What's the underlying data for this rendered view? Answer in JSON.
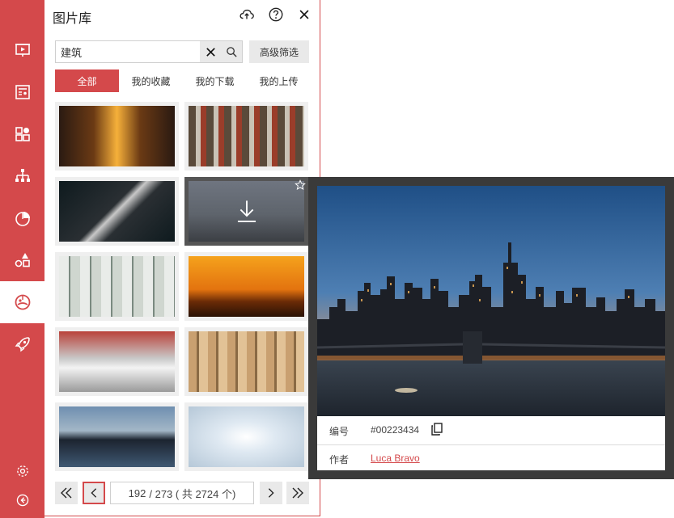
{
  "sidebar": {
    "items": [
      {
        "icon": "presentation-icon"
      },
      {
        "icon": "newspaper-icon"
      },
      {
        "icon": "shapes-grid-icon"
      },
      {
        "icon": "org-chart-icon"
      },
      {
        "icon": "pie-chart-icon"
      },
      {
        "icon": "shapes-icon"
      },
      {
        "icon": "image-library-icon",
        "active": true
      },
      {
        "icon": "rocket-icon"
      }
    ],
    "bottom": [
      {
        "icon": "gear-icon"
      },
      {
        "icon": "back-arrow-icon"
      }
    ]
  },
  "panel": {
    "title": "图片库",
    "header_icons": [
      "cloud-upload-icon",
      "help-icon",
      "close-icon"
    ]
  },
  "search": {
    "value": "建筑",
    "placeholder": "",
    "advanced_label": "高级筛选"
  },
  "tabs": [
    {
      "label": "全部",
      "active": true
    },
    {
      "label": "我的收藏",
      "active": false
    },
    {
      "label": "我的下载",
      "active": false
    },
    {
      "label": "我的上传",
      "active": false
    }
  ],
  "thumbnails": [
    "sunset-street",
    "lights-alley",
    "building-neon",
    "city-skyline-hover",
    "glass-atrium",
    "orange-skyline",
    "brick-buildings",
    "wood-facade",
    "skyline-water",
    "white-corridor"
  ],
  "pagination": {
    "current": "192",
    "total_text": "/ 273 ( 共 2724 个)"
  },
  "preview": {
    "id_label": "编号",
    "id_value": "#00223434",
    "author_label": "作者",
    "author_value": "Luca Bravo"
  },
  "colors": {
    "accent": "#d4494b",
    "button_bg": "#e9e9e9",
    "preview_frame": "#3a3a3a"
  }
}
